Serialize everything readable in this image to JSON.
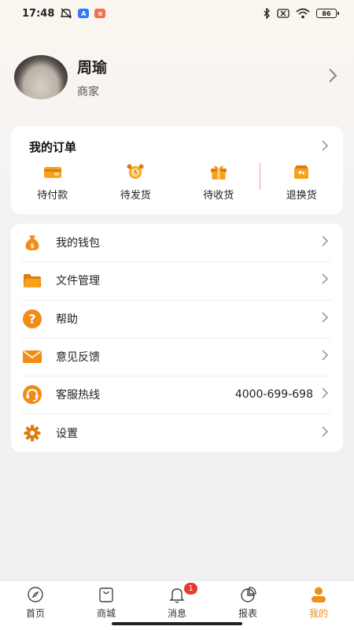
{
  "status_bar": {
    "time": "17:48",
    "battery": "86",
    "icons": [
      "mute-icon",
      "app-a-icon",
      "app-b-icon",
      "bluetooth-icon",
      "no-sim-icon",
      "wifi-icon",
      "battery-icon"
    ]
  },
  "profile": {
    "name": "周瑜",
    "role": "商家"
  },
  "orders": {
    "title": "我的订单",
    "items": [
      {
        "label": "待付款",
        "icon": "wallet-icon"
      },
      {
        "label": "待发货",
        "icon": "alarm-clock-icon"
      },
      {
        "label": "待收货",
        "icon": "gift-box-icon"
      },
      {
        "label": "退换货",
        "icon": "return-icon"
      }
    ]
  },
  "menu": [
    {
      "label": "我的钱包",
      "icon": "money-bag-icon",
      "value": ""
    },
    {
      "label": "文件管理",
      "icon": "folder-icon",
      "value": ""
    },
    {
      "label": "帮助",
      "icon": "help-icon",
      "value": ""
    },
    {
      "label": "意见反馈",
      "icon": "mail-icon",
      "value": ""
    },
    {
      "label": "客服热线",
      "icon": "headset-icon",
      "value": "4000-699-698"
    },
    {
      "label": "设置",
      "icon": "gear-icon",
      "value": ""
    }
  ],
  "tabs": [
    {
      "label": "首页",
      "icon": "compass-icon",
      "active": false
    },
    {
      "label": "商城",
      "icon": "shopping-bag-icon",
      "active": false
    },
    {
      "label": "消息",
      "icon": "bell-icon",
      "active": false,
      "badge": "1"
    },
    {
      "label": "报表",
      "icon": "pie-chart-icon",
      "active": false
    },
    {
      "label": "我的",
      "icon": "person-icon",
      "active": true
    }
  ],
  "colors": {
    "accent": "#f28c18",
    "badge": "#e6392f",
    "divider": "#f2a0a0"
  }
}
